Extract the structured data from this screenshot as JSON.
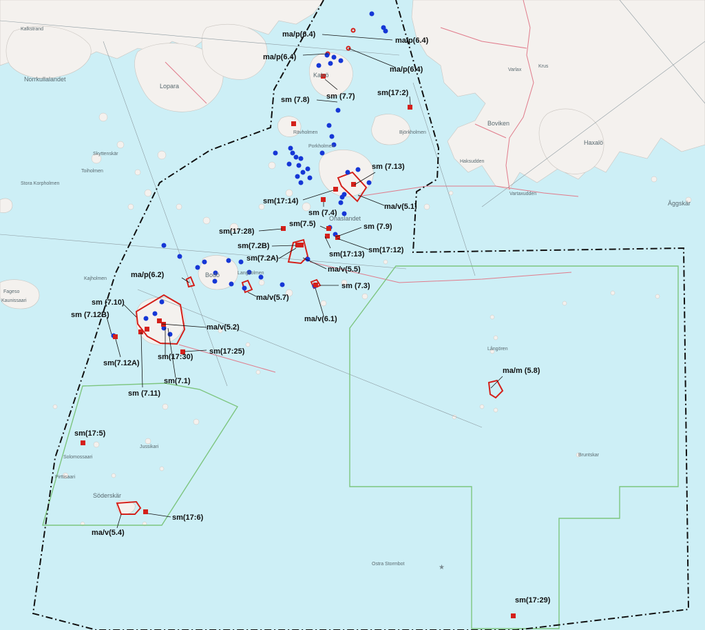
{
  "colors": {
    "sea": "#cdeff6",
    "land": "#f4f1ee",
    "green_zone": "#7dc57f",
    "sample_red": "#d4201a",
    "observation_blue": "#1637d6",
    "boundary": "#111111",
    "road": "#e07a8a"
  },
  "annotations": [
    {
      "text": "ma/p(6.4)"
    },
    {
      "text": "ma/p(6.4)"
    },
    {
      "text": "ma/p(6.4)"
    },
    {
      "text": "ma/p(6.4)"
    },
    {
      "text": "sm (7.7)"
    },
    {
      "text": "sm(17:2)"
    },
    {
      "text": "sm (7.8)"
    },
    {
      "text": "sm (7.13)"
    },
    {
      "text": "sm(17:14)"
    },
    {
      "text": "ma/v(5.1)"
    },
    {
      "text": "sm (7.4)"
    },
    {
      "text": "sm(17:28)"
    },
    {
      "text": "sm(7.5)"
    },
    {
      "text": "sm (7.9)"
    },
    {
      "text": "sm(7.2B)"
    },
    {
      "text": "sm(17:12)"
    },
    {
      "text": "sm(7.2A)"
    },
    {
      "text": "sm(17:13)"
    },
    {
      "text": "ma/v(5.5)"
    },
    {
      "text": "ma/p(6.2)"
    },
    {
      "text": "sm (7.3)"
    },
    {
      "text": "ma/v(5.7)"
    },
    {
      "text": "ma/v(6.1)"
    },
    {
      "text": "sm (7.10)"
    },
    {
      "text": "sm (7.12B)"
    },
    {
      "text": "ma/v(5.2)"
    },
    {
      "text": "sm(17:25)"
    },
    {
      "text": "sm(7.12A)"
    },
    {
      "text": "sm(17:30)"
    },
    {
      "text": "sm(7.1)"
    },
    {
      "text": "sm (7.11)"
    },
    {
      "text": "ma/m (5.8)"
    },
    {
      "text": "sm(17:5)"
    },
    {
      "text": "sm(17:6)"
    },
    {
      "text": "ma/v(5.4)"
    },
    {
      "text": "sm(17:29)"
    }
  ],
  "place_names": [
    {
      "text": "Kalkstrand"
    },
    {
      "text": "Norrkullalandet"
    },
    {
      "text": "Lopara"
    },
    {
      "text": "Kalvö"
    },
    {
      "text": "Bodö"
    },
    {
      "text": "Onaslandet"
    },
    {
      "text": "Boviken"
    },
    {
      "text": "Varlax"
    },
    {
      "text": "Haxalö"
    },
    {
      "text": "Vartaxudden"
    },
    {
      "text": "Äggskär"
    },
    {
      "text": "Söderskär"
    },
    {
      "text": "Långören"
    },
    {
      "text": "Björkholmen"
    },
    {
      "text": "Haksudden"
    },
    {
      "text": "Stora Korpholmen"
    },
    {
      "text": "Ostra Stormbot"
    },
    {
      "text": "Fageso"
    },
    {
      "text": "Kaunissaari"
    },
    {
      "text": "Solomossaari"
    },
    {
      "text": "Pirttisaari"
    },
    {
      "text": "Jussikari"
    },
    {
      "text": "Kajholmen"
    },
    {
      "text": "Skyttenskär"
    },
    {
      "text": "Toiholmen"
    },
    {
      "text": "Rävholmen"
    },
    {
      "text": "Porkholmen"
    },
    {
      "text": "Langholmen"
    },
    {
      "text": "Bruntskar"
    },
    {
      "text": "Krus"
    }
  ]
}
